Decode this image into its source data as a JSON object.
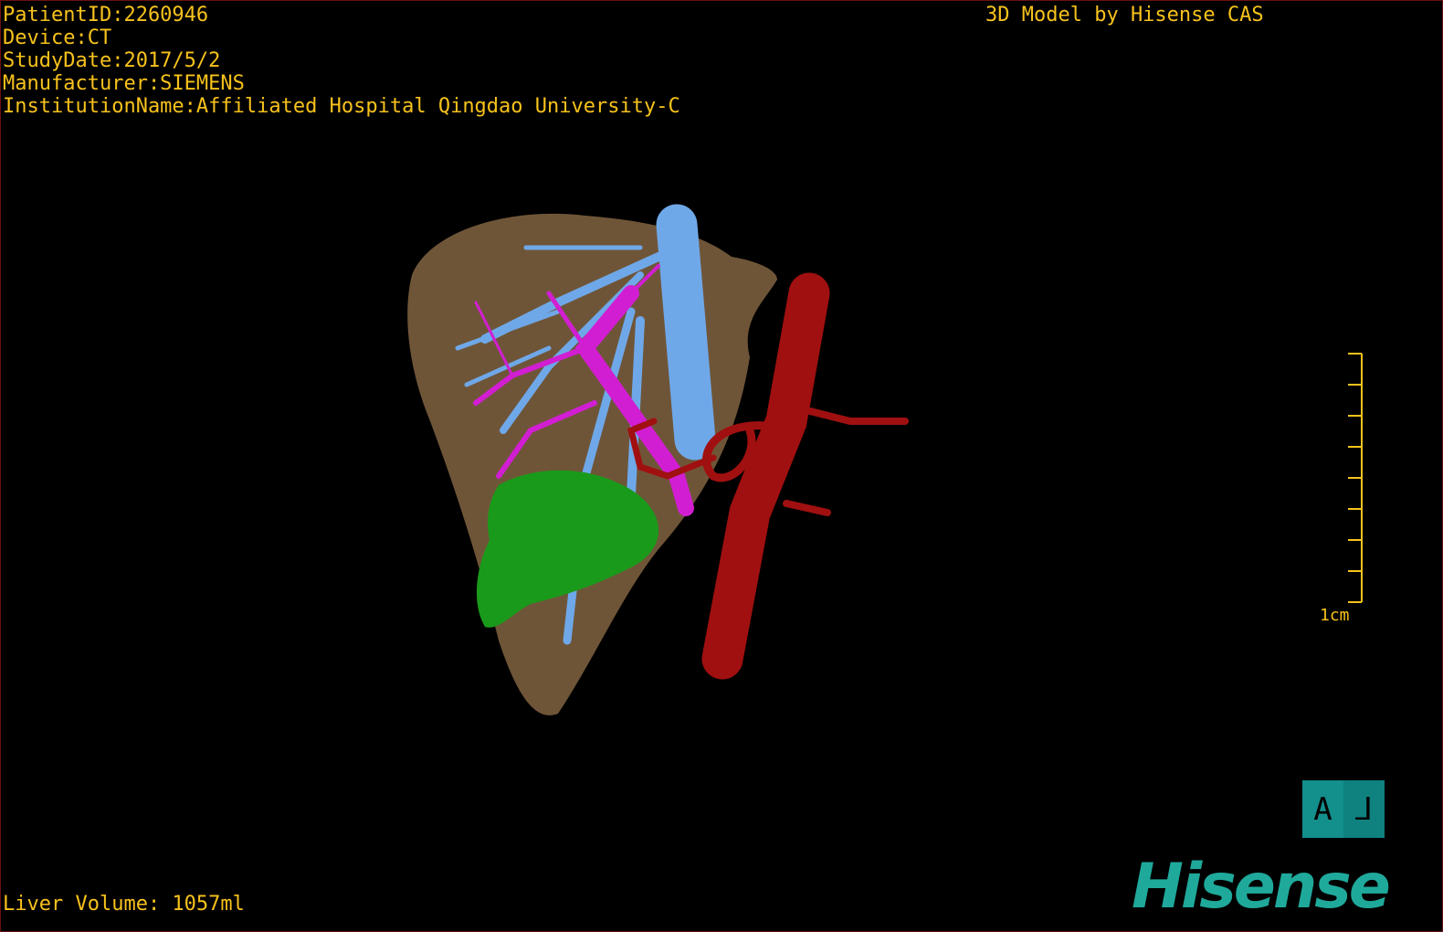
{
  "info": {
    "patient_id": "PatientID:2260946",
    "device": "Device:CT",
    "study_date": "StudyDate:2017/5/2",
    "manufacturer": "Manufacturer:SIEMENS",
    "institution": "InstitutionName:Affiliated Hospital Qingdao University-C"
  },
  "brand_caption": "3D Model by Hisense CAS",
  "liver_volume": "Liver Volume: 1057ml",
  "scale_bar": {
    "label": "1cm",
    "ticks": 9
  },
  "orientation": {
    "letter": "A",
    "marker": "⅃"
  },
  "logo": "Hisense",
  "colors": {
    "text": "#f7c21c",
    "liver": "#7a5f3f",
    "portal_vein": "#6fa8e8",
    "bile_duct": "#d21ed2",
    "artery": "#a01010",
    "tumor": "#1a9a1a",
    "brand": "#1fa99b"
  }
}
